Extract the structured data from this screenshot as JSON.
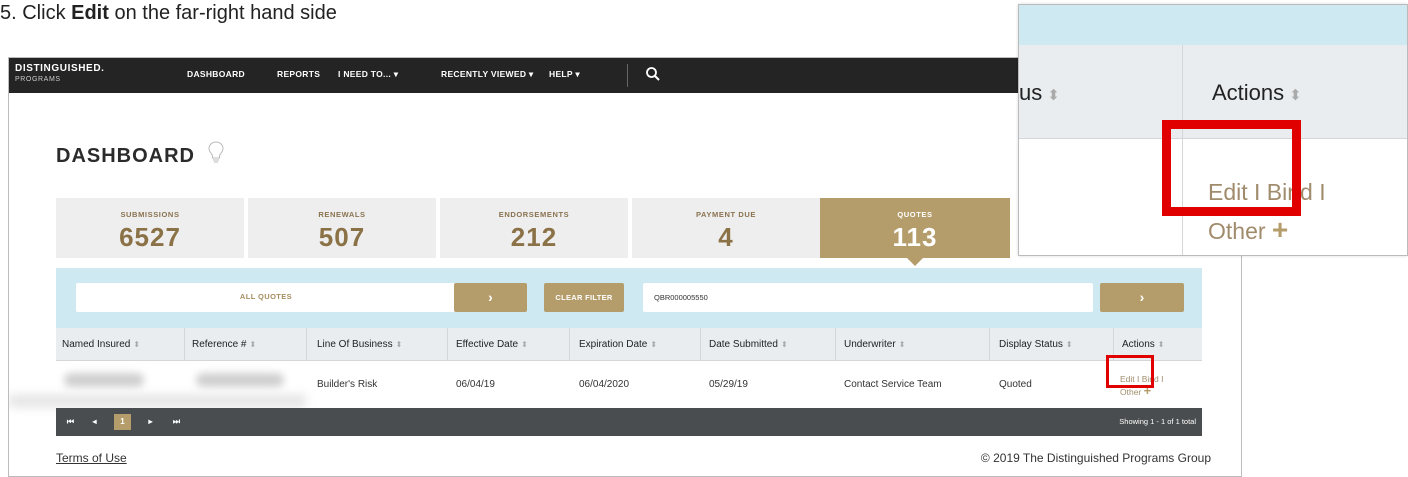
{
  "instruction": {
    "prefix": "5.  Click ",
    "bold": "Edit",
    "suffix": " on the far-right hand side"
  },
  "nav": {
    "logo_main": "DISTINGUISHED.",
    "logo_sub": "PROGRAMS",
    "items": [
      "DASHBOARD",
      "REPORTS",
      "I NEED TO... ▾",
      "RECENTLY VIEWED ▾",
      "HELP ▾"
    ],
    "search_icon": "search-icon"
  },
  "page_title": "DASHBOARD",
  "tiles": [
    {
      "label": "SUBMISSIONS",
      "value": "6527"
    },
    {
      "label": "RENEWALS",
      "value": "507"
    },
    {
      "label": "ENDORSEMENTS",
      "value": "212"
    },
    {
      "label": "PAYMENT DUE",
      "value": "4"
    },
    {
      "label": "QUOTES",
      "value": "113"
    }
  ],
  "filter": {
    "all_label": "ALL QUOTES",
    "arrow": "›",
    "clear_label": "CLEAR FILTER",
    "search_value": "QBR000005550"
  },
  "table": {
    "headers": [
      "Named Insured",
      "Reference #",
      "Line Of Business",
      "Effective Date",
      "Expiration Date",
      "Date Submitted",
      "Underwriter",
      "Display Status",
      "Actions"
    ],
    "sort_glyph": "⬍",
    "row": {
      "line_of_business": "Builder's Risk",
      "effective_date": "06/04/19",
      "expiration_date": "06/04/2020",
      "date_submitted": "05/29/19",
      "underwriter": "Contact Service Team",
      "display_status": "Quoted",
      "actions_line1": "Edit I Bind I",
      "actions_line2": "Other",
      "plus": "+"
    }
  },
  "pager": {
    "first": "⏮",
    "prev": "◂",
    "current": "1",
    "next": "▸",
    "last": "⏭",
    "showing": "Showing 1 - 1 of 1 total"
  },
  "footer": {
    "terms": "Terms of Use",
    "copyright": "© 2019 The Distinguished Programs Group"
  },
  "zoom": {
    "status_header_fragment": "us",
    "actions_header": "Actions",
    "links_line1": "Edit I Bind I",
    "links_line2": "Other",
    "plus": "+"
  },
  "colors": {
    "gold": "#b59d6b",
    "highlight_red": "#e00000",
    "nav_bg": "#242424",
    "filter_bg": "#cfe9f3"
  }
}
